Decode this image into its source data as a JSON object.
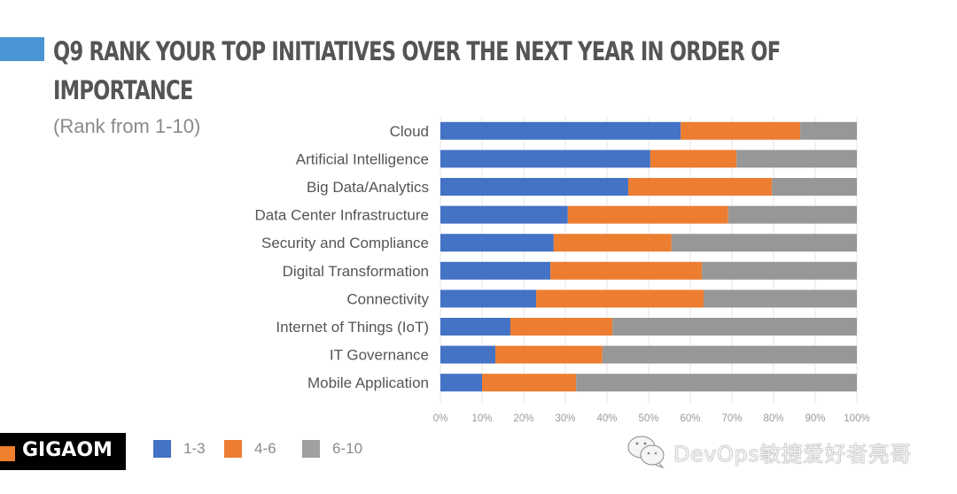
{
  "header": {
    "title_line1": "Q9 RANK YOUR TOP INITIATIVES OVER THE NEXT YEAR IN ORDER OF",
    "title_line2": "IMPORTANCE",
    "subtitle": "(Rank from 1-10)"
  },
  "logo": {
    "text": "GIGAOM"
  },
  "watermark": {
    "text": "DevOps敏捷爱好者亮哥",
    "icon": "wechat-icon"
  },
  "colors": {
    "accent": "#4b94d3",
    "series_1_3": "#4472c4",
    "series_4_6": "#ed7d31",
    "series_6_10": "#979797",
    "logo_orange": "#ee7f2d"
  },
  "chart_data": {
    "type": "bar",
    "orientation": "horizontal",
    "stacked": "100%",
    "title": "Q9 Rank your top initiatives over the next year in order of importance",
    "subtitle": "(Rank from 1-10)",
    "categories": [
      "Cloud",
      "Artificial Intelligence",
      "Big Data/Analytics",
      "Data Center Infrastructure",
      "Security and Compliance",
      "Digital Transformation",
      "Connectivity",
      "Internet of Things (IoT)",
      "IT Governance",
      "Mobile Application"
    ],
    "series": [
      {
        "name": "1-3",
        "color": "#4472c4",
        "values": [
          57.7,
          50.4,
          45.1,
          30.6,
          27.2,
          26.4,
          23.0,
          16.8,
          13.2,
          10.0
        ]
      },
      {
        "name": "4-6",
        "color": "#ed7d31",
        "values": [
          28.7,
          20.7,
          34.5,
          38.5,
          28.3,
          36.4,
          40.2,
          24.5,
          25.7,
          22.6
        ]
      },
      {
        "name": "6-10",
        "color": "#979797",
        "values": [
          13.6,
          28.9,
          20.4,
          30.9,
          44.5,
          37.2,
          36.8,
          58.7,
          61.1,
          67.4
        ]
      }
    ],
    "xlabel": "",
    "ylabel": "",
    "xlim": [
      0,
      100
    ],
    "xticks": [
      "0%",
      "10%",
      "20%",
      "30%",
      "40%",
      "50%",
      "60%",
      "70%",
      "80%",
      "90%",
      "100%"
    ],
    "grid": true,
    "legend": {
      "position": "bottom-left",
      "entries": [
        "1-3",
        "4-6",
        "6-10"
      ]
    }
  }
}
